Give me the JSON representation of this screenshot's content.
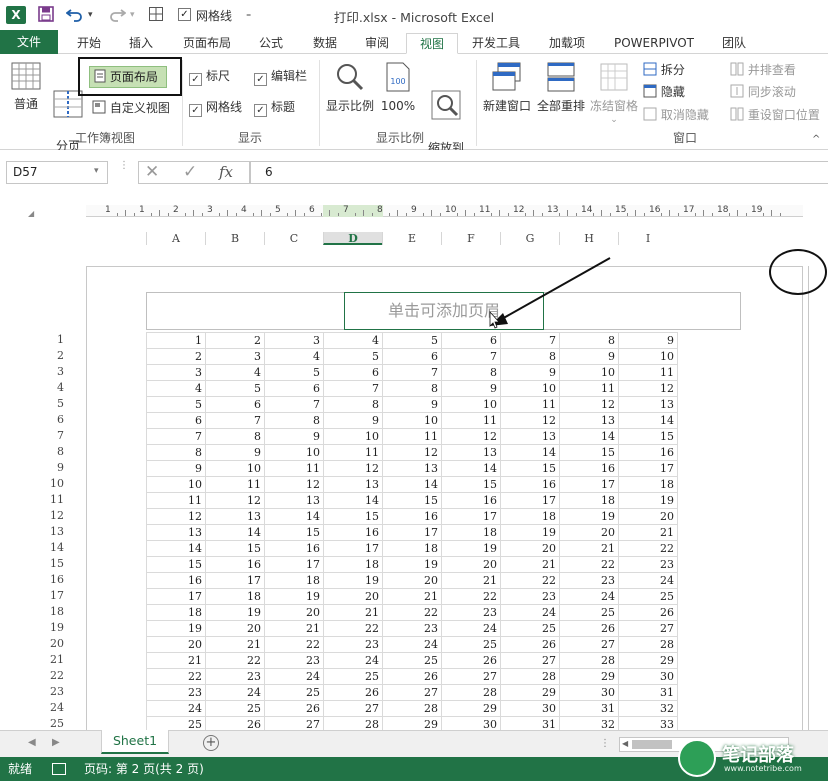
{
  "app": {
    "logo": "X",
    "title": "打印.xlsx - Microsoft Excel",
    "qat_gridlines_label": "网格线"
  },
  "tabs": [
    {
      "label": "文件"
    },
    {
      "label": "开始"
    },
    {
      "label": "插入"
    },
    {
      "label": "页面布局"
    },
    {
      "label": "公式"
    },
    {
      "label": "数据"
    },
    {
      "label": "审阅"
    },
    {
      "label": "视图"
    },
    {
      "label": "开发工具"
    },
    {
      "label": "加载项"
    },
    {
      "label": "POWERPIVOT"
    },
    {
      "label": "团队"
    }
  ],
  "ribbon": {
    "workbook_views": {
      "label": "工作簿视图",
      "normal": "普通",
      "page_break": "分页\n预览",
      "page_layout": "页面布局",
      "custom_views": "自定义视图"
    },
    "show": {
      "label": "显示",
      "ruler": "标尺",
      "formula_bar": "编辑栏",
      "gridlines": "网格线",
      "headings": "标题"
    },
    "zoom": {
      "label": "显示比例",
      "zoom": "显示比例",
      "hundred": "100%",
      "zoom_selection": "缩放到\n选定区域"
    },
    "window": {
      "label": "窗口",
      "new_window": "新建窗口",
      "arrange_all": "全部重排",
      "freeze_panes": "冻结窗格",
      "split": "拆分",
      "hide": "隐藏",
      "unhide": "取消隐藏",
      "side_by_side": "并排查看",
      "sync_scroll": "同步滚动",
      "reset_position": "重设窗口位置"
    }
  },
  "formula_bar": {
    "name_box": "D57",
    "value": "6",
    "fx": "fx"
  },
  "ruler_numbers": [
    "1",
    "1",
    "2",
    "3",
    "4",
    "5",
    "6",
    "7",
    "8",
    "9",
    "10",
    "11",
    "12",
    "13",
    "14",
    "15",
    "16",
    "17",
    "18",
    "19"
  ],
  "columns": [
    "A",
    "B",
    "C",
    "D",
    "E",
    "F",
    "G",
    "H",
    "I"
  ],
  "selected_column": "D",
  "header_placeholder": "单击可添加页眉",
  "rows": [
    [
      1,
      2,
      3,
      4,
      5,
      6,
      7,
      8,
      9
    ],
    [
      2,
      3,
      4,
      5,
      6,
      7,
      8,
      9,
      10
    ],
    [
      3,
      4,
      5,
      6,
      7,
      8,
      9,
      10,
      11
    ],
    [
      4,
      5,
      6,
      7,
      8,
      9,
      10,
      11,
      12
    ],
    [
      5,
      6,
      7,
      8,
      9,
      10,
      11,
      12,
      13
    ],
    [
      6,
      7,
      8,
      9,
      10,
      11,
      12,
      13,
      14
    ],
    [
      7,
      8,
      9,
      10,
      11,
      12,
      13,
      14,
      15
    ],
    [
      8,
      9,
      10,
      11,
      12,
      13,
      14,
      15,
      16
    ],
    [
      9,
      10,
      11,
      12,
      13,
      14,
      15,
      16,
      17
    ],
    [
      10,
      11,
      12,
      13,
      14,
      15,
      16,
      17,
      18
    ],
    [
      11,
      12,
      13,
      14,
      15,
      16,
      17,
      18,
      19
    ],
    [
      12,
      13,
      14,
      15,
      16,
      17,
      18,
      19,
      20
    ],
    [
      13,
      14,
      15,
      16,
      17,
      18,
      19,
      20,
      21
    ],
    [
      14,
      15,
      16,
      17,
      18,
      19,
      20,
      21,
      22
    ],
    [
      15,
      16,
      17,
      18,
      19,
      20,
      21,
      22,
      23
    ],
    [
      16,
      17,
      18,
      19,
      20,
      21,
      22,
      23,
      24
    ],
    [
      17,
      18,
      19,
      20,
      21,
      22,
      23,
      24,
      25
    ],
    [
      18,
      19,
      20,
      21,
      22,
      23,
      24,
      25,
      26
    ],
    [
      19,
      20,
      21,
      22,
      23,
      24,
      25,
      26,
      27
    ],
    [
      20,
      21,
      22,
      23,
      24,
      25,
      26,
      27,
      28
    ],
    [
      21,
      22,
      23,
      24,
      25,
      26,
      27,
      28,
      29
    ],
    [
      22,
      23,
      24,
      25,
      26,
      27,
      28,
      29,
      30
    ],
    [
      23,
      24,
      25,
      26,
      27,
      28,
      29,
      30,
      31
    ],
    [
      24,
      25,
      26,
      27,
      28,
      29,
      30,
      31,
      32
    ],
    [
      25,
      26,
      27,
      28,
      29,
      30,
      31,
      32,
      33
    ]
  ],
  "sheet_tab": "Sheet1",
  "status": {
    "ready": "就绪",
    "page": "页码: 第 2 页(共 2 页)"
  },
  "watermark": {
    "name": "笔记部落",
    "url": "www.notetribe.com"
  },
  "colors": {
    "excel_green": "#217346",
    "page_layout_highlight": "#c6e0b4"
  }
}
